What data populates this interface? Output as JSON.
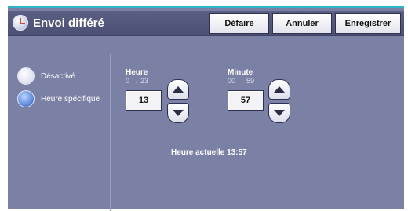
{
  "header": {
    "title": "Envoi différé",
    "icon": "clock-icon",
    "buttons": {
      "undo": "Défaire",
      "cancel": "Annuler",
      "save": "Enregistrer"
    }
  },
  "options": [
    {
      "label": "Désactivé",
      "selected": false
    },
    {
      "label": "Heure spécifique",
      "selected": true
    }
  ],
  "hour": {
    "label": "Heure",
    "range": "0 → 23",
    "value": "13"
  },
  "minute": {
    "label": "Minute",
    "range": "00 → 59",
    "value": "57"
  },
  "current_time": "Heure actuelle  13:57",
  "colors": {
    "accent_line": "#2fb3c8",
    "panel_bg": "#7b80a5",
    "titlebar_bg": "#4c5074",
    "selected_radio": "#5c86d8"
  }
}
